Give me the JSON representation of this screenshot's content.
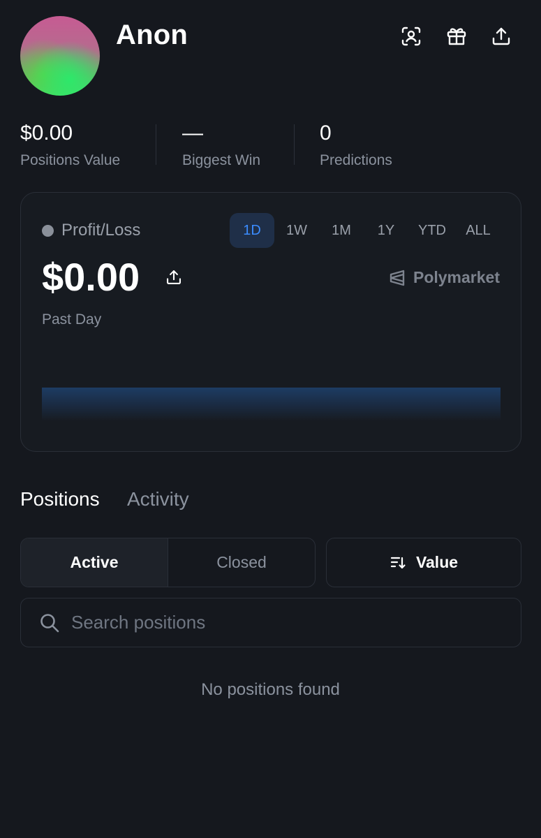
{
  "profile": {
    "name": "Anon",
    "header_icons": [
      "scan-face-icon",
      "gift-icon",
      "share-icon"
    ]
  },
  "stats": [
    {
      "value": "$0.00",
      "label": "Positions Value"
    },
    {
      "value": "—",
      "label": "Biggest Win"
    },
    {
      "value": "0",
      "label": "Predictions"
    }
  ],
  "pnl": {
    "label": "Profit/Loss",
    "ranges": [
      "1D",
      "1W",
      "1M",
      "1Y",
      "YTD",
      "ALL"
    ],
    "selected_range": "1D",
    "value": "$0.00",
    "period": "Past Day",
    "brand": "Polymarket"
  },
  "tabs": {
    "positions": "Positions",
    "activity": "Activity",
    "selected": "Positions"
  },
  "filter": {
    "active": "Active",
    "closed": "Closed",
    "selected": "Active",
    "sort_label": "Value"
  },
  "search": {
    "placeholder": "Search positions",
    "value": ""
  },
  "empty_state": "No positions found",
  "colors": {
    "background": "#15181e",
    "accent": "#3b8cff",
    "muted": "#8b929e"
  }
}
